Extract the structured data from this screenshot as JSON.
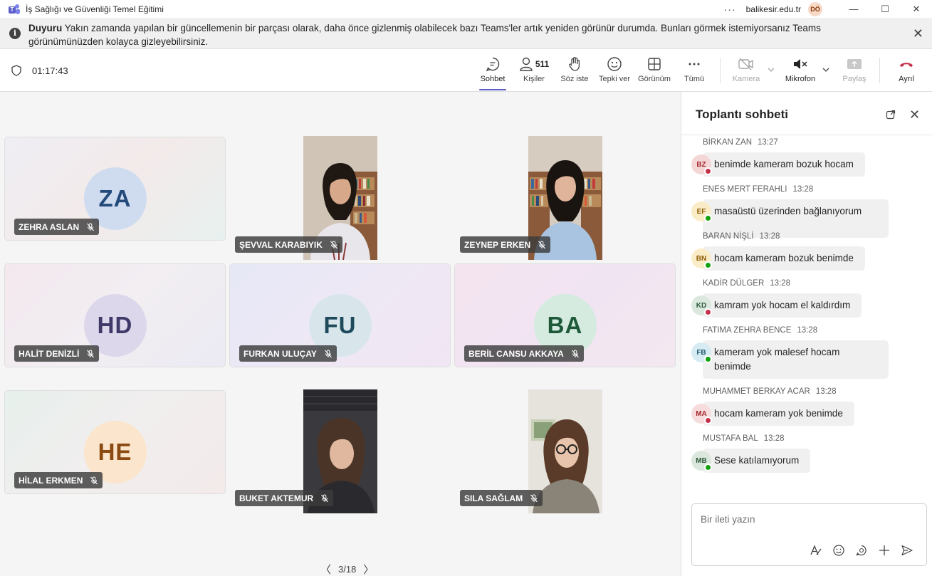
{
  "window": {
    "title": "İş Sağlığı ve Güvenliği Temel Eğitimi",
    "more_label": "···",
    "domain": "balikesir.edu.tr",
    "user_initials": "DÖ",
    "minimize_label": "—",
    "maximize_label": "☐",
    "close_label": "✕"
  },
  "banner": {
    "bold": "Duyuru",
    "text": " Yakın zamanda yapılan bir güncellemenin bir parçası olarak, daha önce gizlenmiş olabilecek bazı Teams'ler artık yeniden görünür durumda. Bunları görmek istemiyorsanız Teams görünümünüzden kolayca gizleyebilirsiniz.",
    "close_label": "✕"
  },
  "meeting": {
    "timer": "01:17:43",
    "toolbar": {
      "chat": "Sohbet",
      "people": "Kişiler",
      "people_count": "511",
      "raise": "Söz iste",
      "react": "Tepki ver",
      "view": "Görünüm",
      "more": "Tümü",
      "camera": "Kamera",
      "mic": "Mikrofon",
      "share": "Paylaş",
      "leave": "Ayrıl"
    }
  },
  "tiles": [
    {
      "name": "ZEHRA ASLAN",
      "initials": "ZA",
      "av_bg": "#cfdcf0",
      "av_fg": "#234a7a",
      "bg": "linear-gradient(135deg,#efeef4 0%,#f3eaea 50%,#e8f1ef 100%)"
    },
    {
      "name": "ŞEVVAL KARABIYIK",
      "video": true
    },
    {
      "name": "ZEYNEP ERKEN",
      "video": true
    },
    {
      "name": "HALİT DENİZLİ",
      "initials": "HD",
      "av_bg": "#ddd7ec",
      "av_fg": "#3e3968",
      "bg": "linear-gradient(135deg,#f3e8ee 0%,#f2eef2 50%,#ebeaf3 100%)"
    },
    {
      "name": "FURKAN ULUÇAY",
      "initials": "FU",
      "av_bg": "#d8e6ec",
      "av_fg": "#1e4a5c",
      "bg": "linear-gradient(135deg,#e6e8f6 0%,#eee8f5 50%,#f1e6f3 100%)"
    },
    {
      "name": "BERİL CANSU AKKAYA",
      "initials": "BA",
      "av_bg": "#d5ebdf",
      "av_fg": "#1e5a3a",
      "bg": "linear-gradient(135deg,#f4e4f0 0%,#f1e4f2 50%,#f3e8f0 100%)"
    },
    {
      "name": "HİLAL ERKMEN",
      "initials": "HE",
      "av_bg": "#fbe5cc",
      "av_fg": "#8a4a12",
      "bg": "linear-gradient(135deg,#e7f0ec 0%,#f1eeee 50%,#f3eaea 100%)"
    },
    {
      "name": "BUKET AKTEMUR",
      "video": true
    },
    {
      "name": "SILA SAĞLAM",
      "video": true
    }
  ],
  "pager": {
    "prev": "〈",
    "label": "3/18",
    "next": "〉"
  },
  "chat": {
    "title": "Toplantı sohbeti",
    "close_label": "✕",
    "messages": [
      {
        "author": "BİRKAN ZAN",
        "time": "13:27",
        "initials": "BZ",
        "text": "benimde kameram bozuk hocam",
        "status": "busy",
        "av_bg": "#f4d6d6",
        "av_fg": "#a4262c"
      },
      {
        "author": "ENES MERT FERAHLI",
        "time": "13:28",
        "initials": "EF",
        "text": "masaüstü üzerinden bağlanıyorum",
        "status": "available",
        "av_bg": "#fbecc8",
        "av_fg": "#8a5a00"
      },
      {
        "author": "BARAN NİŞLİ",
        "time": "13:28",
        "initials": "BN",
        "text": "hocam kameram bozuk benimde",
        "status": "available",
        "av_bg": "#fbecc8",
        "av_fg": "#8a5a00"
      },
      {
        "author": "KADİR DÜLGER",
        "time": "13:28",
        "initials": "KD",
        "text": "kamram yok hocam el kaldırdım",
        "status": "busy",
        "av_bg": "#dbe8de",
        "av_fg": "#2e5a3a"
      },
      {
        "author": "FATIMA ZEHRA BENCE",
        "time": "13:28",
        "initials": "FB",
        "text": "kameram yok malesef hocam benimde",
        "status": "available",
        "av_bg": "#d6ecf2",
        "av_fg": "#1e5a70"
      },
      {
        "author": "MUHAMMET BERKAY ACAR",
        "time": "13:28",
        "initials": "MA",
        "text": "hocam kameram yok benimde",
        "status": "busy",
        "av_bg": "#f6dcdc",
        "av_fg": "#a4262c"
      },
      {
        "author": "MUSTAFA BAL",
        "time": "13:28",
        "initials": "MB",
        "text": "Sese katılamıyorum",
        "status": "available",
        "av_bg": "#dbe6dd",
        "av_fg": "#2e5a3a"
      }
    ],
    "composer": {
      "placeholder": "Bir ileti yazın"
    }
  },
  "colors": {
    "accent": "#5b5fc7",
    "busy": "#c4314b",
    "available": "#13a10e",
    "leave": "#c4314b"
  }
}
